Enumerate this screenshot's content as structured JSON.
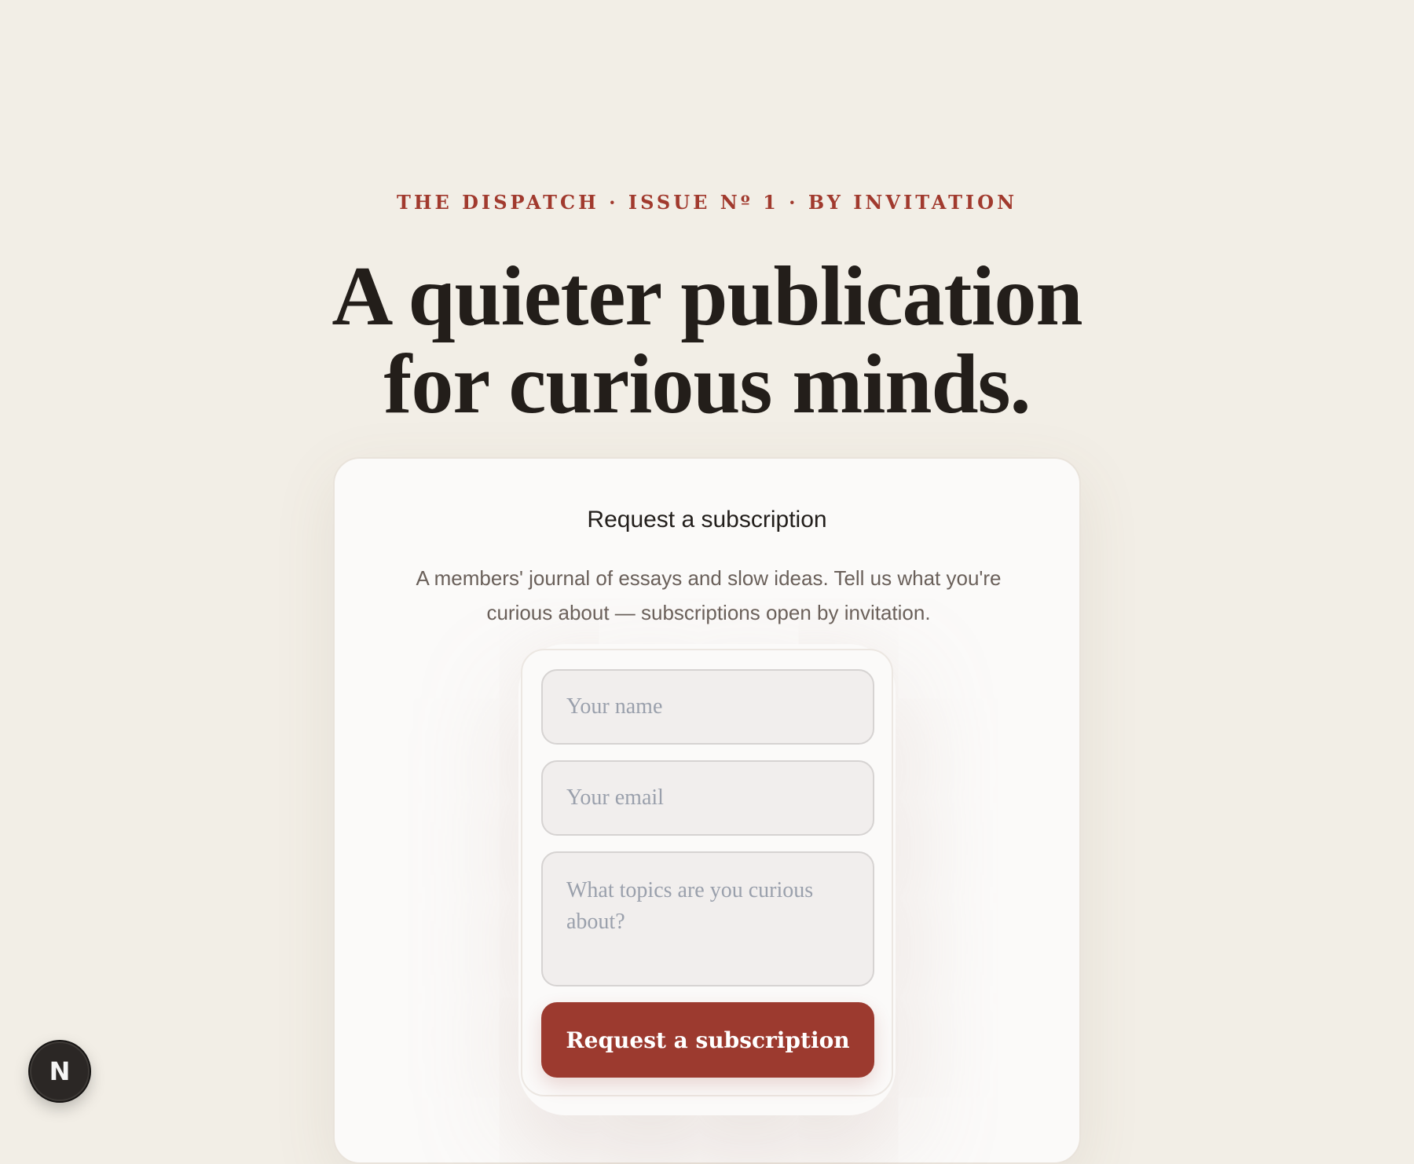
{
  "hero": {
    "eyebrow": "THE DISPATCH · ISSUE Nº 1 · BY INVITATION",
    "headline_line1": "A quieter publication",
    "headline_line2": "for curious minds."
  },
  "card": {
    "title": "Request a subscription",
    "description": "A members' journal of essays and slow ideas. Tell us what you're curious about — subscriptions open by invitation."
  },
  "form": {
    "name_placeholder": "Your name",
    "email_placeholder": "Your email",
    "topics_placeholder": "What topics are you curious about?",
    "submit_label": "Request a subscription"
  },
  "badge": {
    "letter": "N",
    "icon": "nextjs-icon"
  },
  "colors": {
    "background": "#f2eee6",
    "accent": "#9c3a2f",
    "eyebrow": "#a13a2e",
    "headline": "#231e1a"
  }
}
